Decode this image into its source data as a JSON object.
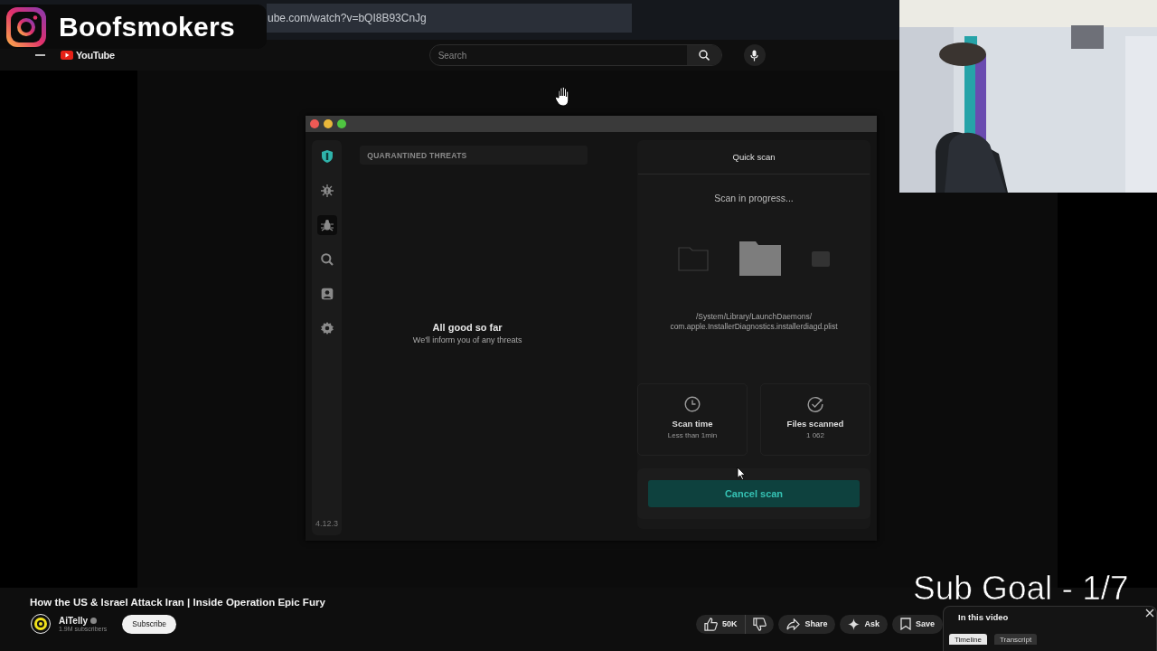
{
  "overlay": {
    "streamer_name": "Boofsmokers",
    "sub_goal": "Sub Goal - 1/7"
  },
  "browser": {
    "url": "ube.com/watch?v=bQI8B93CnJg"
  },
  "youtube_header": {
    "logo": "YouTube",
    "search": {
      "placeholder": "Search"
    }
  },
  "app_window": {
    "sidebar": {
      "items": [
        {
          "kind": "shield",
          "selected": false
        },
        {
          "kind": "virus",
          "selected": false
        },
        {
          "kind": "bug",
          "selected": true
        },
        {
          "kind": "search",
          "selected": false
        },
        {
          "kind": "contact",
          "selected": false
        },
        {
          "kind": "gear",
          "selected": false
        }
      ],
      "version": "4.12.3"
    },
    "quarantine": {
      "header": "QUARANTINED THREATS",
      "title": "All good so far",
      "subtitle": "We'll inform you of any threats"
    },
    "scan": {
      "title": "Quick scan",
      "status": "Scan in progress...",
      "path_lines": [
        "/System/Library/LaunchDaemons/",
        "com.apple.InstallerDiagnostics.installerdiagd.plist"
      ],
      "stats": [
        {
          "kind": "clock",
          "label": "Scan time",
          "value": "Less than 1min"
        },
        {
          "kind": "check",
          "label": "Files scanned",
          "value": "1 062"
        }
      ],
      "cancel_button": "Cancel scan"
    }
  },
  "video": {
    "title": "How the US & Israel Attack Iran | Inside Operation Epic Fury",
    "channel": {
      "name": "AiTelly",
      "subscribers": "1.9M subscribers",
      "subscribe_button": "Subscribe"
    },
    "actions": [
      {
        "kind": "like",
        "label": "50K"
      },
      {
        "kind": "dislike"
      },
      {
        "kind": "share",
        "label": "Share"
      },
      {
        "kind": "ask",
        "label": "Ask"
      },
      {
        "kind": "save",
        "label": "Save"
      }
    ],
    "chapters_panel": {
      "title": "In this video",
      "tabs": [
        {
          "label": "Timeline",
          "selected": true
        },
        {
          "label": "Transcript",
          "selected": false
        }
      ]
    }
  }
}
